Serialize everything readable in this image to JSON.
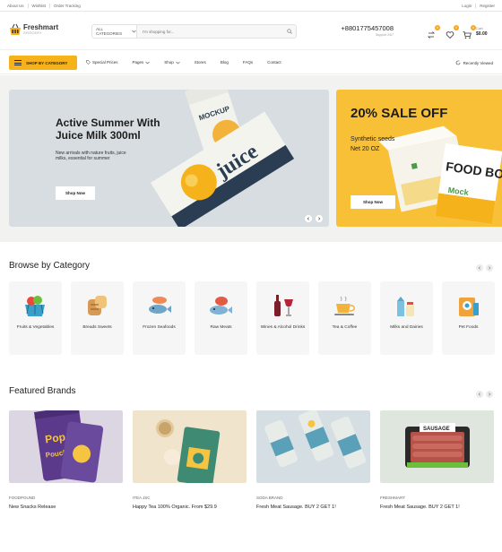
{
  "topbar": {
    "left_links": [
      "About Us",
      "Wishlist",
      "Order Tracking"
    ],
    "right_links": [
      "Login",
      "Register"
    ]
  },
  "header": {
    "logo_name": "Freshmart",
    "logo_sub": "GROCERY",
    "search_category": "ALL CATEGORIES",
    "search_placeholder": "I'm shopping for...",
    "phone": "+8801775457008",
    "phone_label": "Support 24/7",
    "compare_count": "0",
    "wishlist_count": "0",
    "cart_count": "0",
    "cart_label": "Cart",
    "cart_total": "$0.00"
  },
  "nav": {
    "shop_by_category": "SHOP BY CATEGORY",
    "links": [
      "Special Prices",
      "Pages",
      "Shop",
      "Stores",
      "Blog",
      "FAQs",
      "Contact"
    ],
    "recently_viewed": "Recently Viewed"
  },
  "hero": {
    "main": {
      "title": "Active Summer With Juice Milk 300ml",
      "desc": "New arrivals with nature fruits, juice milks, essential for summer",
      "button": "Shop Now",
      "pack_label_1": "MOCKUP",
      "pack_label_2": "juice"
    },
    "side": {
      "title": "20% SALE OFF",
      "desc_line1": "Synthetic seeds",
      "desc_line2": "Net 20 OZ",
      "button": "Shop Now",
      "box_label": "FOOD BOX",
      "box_sub": "Mock"
    },
    "colors": {
      "main_bg": "#d7dde0",
      "side_bg": "#f8c037",
      "accent": "#f5b21b"
    }
  },
  "categories": {
    "title": "Browse by Category",
    "items": [
      {
        "label": "Fruits & Vegetables",
        "icon": "basket-icon"
      },
      {
        "label": "Breads Sweets",
        "icon": "bread-icon"
      },
      {
        "label": "Frozen Seafoods",
        "icon": "fish-icon"
      },
      {
        "label": "Raw Meats",
        "icon": "meat-icon"
      },
      {
        "label": "Wines & Alcohol Drinks",
        "icon": "wine-icon"
      },
      {
        "label": "Tea & Coffee",
        "icon": "coffee-icon"
      },
      {
        "label": "Milks and Dairies",
        "icon": "milk-icon"
      },
      {
        "label": "Pet Foods",
        "icon": "pet-food-icon"
      }
    ]
  },
  "brands": {
    "title": "Featured Brands",
    "items": [
      {
        "tag": "FOODPOUND",
        "desc": "New Snacks Release",
        "pack_text_1": "Pop",
        "pack_text_2": "Pouch"
      },
      {
        "tag": "ITEA JSC",
        "desc": "Happy Tea 100% Organic. From $29.9"
      },
      {
        "tag": "SODA BRAND",
        "desc": "Fresh Meat Sausage. BUY 2 GET 1!"
      },
      {
        "tag": "FRESHMART",
        "desc": "Fresh Meat Sausage. BUY 2 GET 1!",
        "pack_text": "SAUSAGE"
      }
    ]
  }
}
